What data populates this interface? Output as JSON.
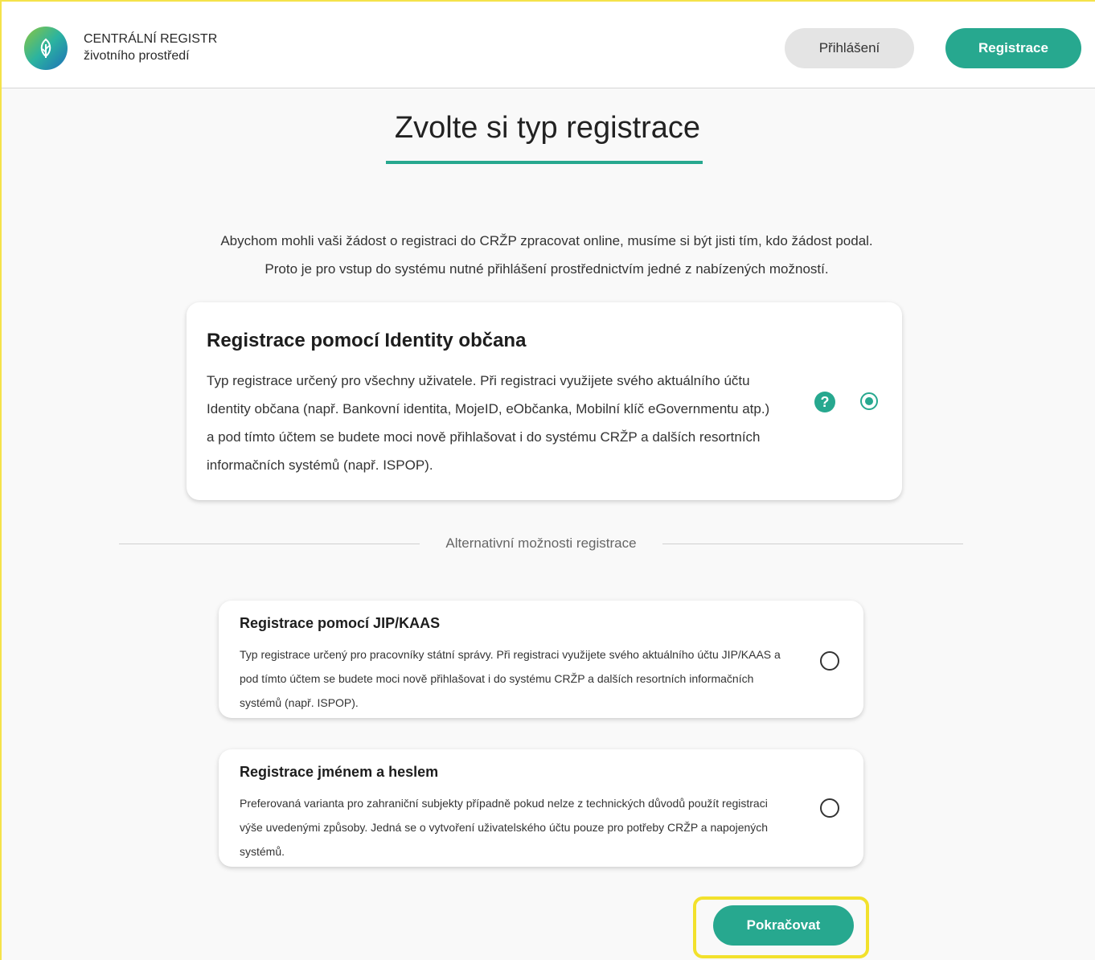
{
  "header": {
    "brand_line1": "CENTRÁLNÍ REGISTR",
    "brand_line2": "životního prostředí",
    "login_label": "Přihlášení",
    "register_label": "Registrace",
    "logo_icon": "leaf-icon"
  },
  "main": {
    "title": "Zvolte si typ registrace",
    "intro_line1": "Abychom mohli vaši žádost o registraci do CRŽP zpracovat online, musíme si být jisti tím, kdo žádost podal.",
    "intro_line2": "Proto je pro vstup do systému nutné přihlášení prostřednictvím jedné z nabízených možností.",
    "options": [
      {
        "title": "Registrace pomocí Identity občana",
        "text": "Typ registrace určený pro všechny uživatele. Při registraci využijete svého aktuálního účtu Identity občana (např. Bankovní identita, MojeID, eObčanka, Mobilní klíč eGovernmentu atp.) a pod tímto účtem se budete moci nově přihlašovat i do systému CRŽP a dalších resortních informačních systémů (např. ISPOP).",
        "selected": true,
        "help_icon": "?"
      },
      {
        "title": "Registrace pomocí JIP/KAAS",
        "text": "Typ registrace určený pro pracovníky státní správy. Při registraci využijete svého aktuálního účtu JIP/KAAS a pod tímto účtem se budete moci nově přihlašovat i do systému CRŽP a dalších resortních informačních systémů (např. ISPOP).",
        "selected": false
      },
      {
        "title": "Registrace jménem a heslem",
        "text": "Preferovaná varianta pro zahraniční subjekty případně pokud nelze z technických důvodů použít registraci výše uvedenými způsoby. Jedná se o vytvoření uživatelského účtu pouze pro potřeby CRŽP a napojených systémů.",
        "selected": false
      }
    ],
    "alt_divider": "Alternativní možnosti registrace",
    "continue_label": "Pokračovat"
  },
  "colors": {
    "accent": "#27a88f",
    "highlight": "#f2e12c"
  }
}
